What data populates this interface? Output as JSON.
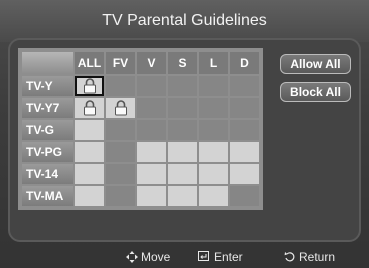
{
  "title": "TV Parental Guidelines",
  "columns": [
    "ALL",
    "FV",
    "V",
    "S",
    "L",
    "D"
  ],
  "rows": [
    {
      "label": "TV-Y",
      "cells": [
        "lock-selected",
        "dark",
        "dark",
        "dark",
        "dark",
        "dark"
      ]
    },
    {
      "label": "TV-Y7",
      "cells": [
        "lock",
        "lock",
        "dark",
        "dark",
        "dark",
        "dark"
      ]
    },
    {
      "label": "TV-G",
      "cells": [
        "light",
        "dark",
        "dark",
        "dark",
        "dark",
        "dark"
      ]
    },
    {
      "label": "TV-PG",
      "cells": [
        "light",
        "dark",
        "light",
        "light",
        "light",
        "light"
      ]
    },
    {
      "label": "TV-14",
      "cells": [
        "light",
        "dark",
        "light",
        "light",
        "light",
        "light"
      ]
    },
    {
      "label": "TV-MA",
      "cells": [
        "light",
        "dark",
        "light",
        "light",
        "light",
        "dark"
      ]
    }
  ],
  "buttons": {
    "allow_all": "Allow All",
    "block_all": "Block All"
  },
  "footer": {
    "move": "Move",
    "enter": "Enter",
    "return": "Return"
  },
  "icons": {
    "lock": "lock-icon",
    "move": "move-arrows-icon",
    "enter": "enter-icon",
    "return": "return-icon"
  }
}
